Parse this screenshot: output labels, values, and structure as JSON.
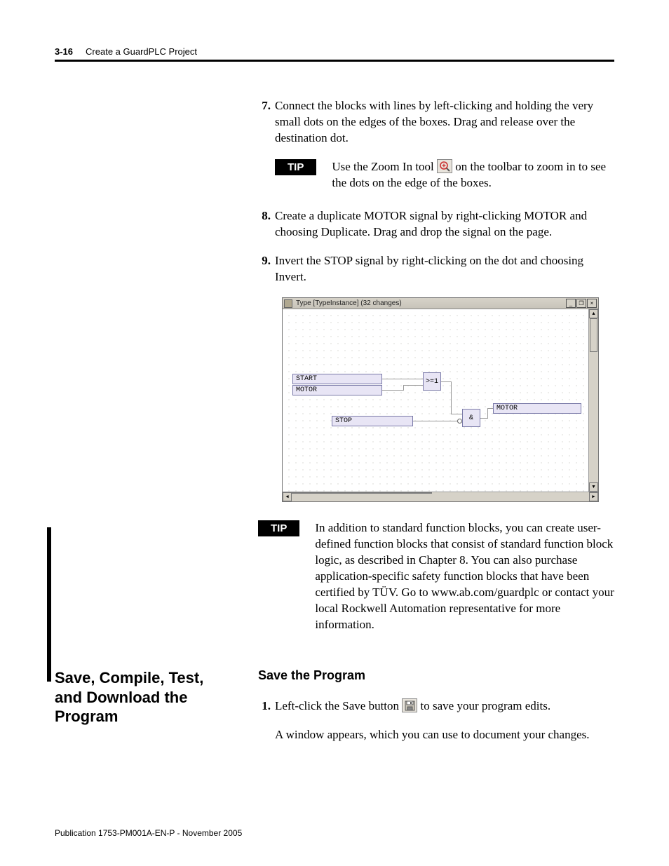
{
  "header": {
    "page_number": "3-16",
    "chapter_title": "Create a GuardPLC Project"
  },
  "steps": {
    "s7": {
      "num": "7.",
      "text": "Connect the blocks with lines by left-clicking and holding the very small dots on the edges of the boxes. Drag and release over the destination dot."
    },
    "s8": {
      "num": "8.",
      "text": "Create a duplicate MOTOR signal by right-clicking MOTOR and choosing Duplicate. Drag and drop the signal on the page."
    },
    "s9": {
      "num": "9.",
      "text": "Invert the STOP signal by right-clicking on the dot and choosing Invert."
    }
  },
  "tip1": {
    "label": "TIP",
    "before": "Use the Zoom In tool ",
    "after": " on the toolbar to zoom in to see the dots on the edge of the boxes."
  },
  "screenshot": {
    "title": "Type [TypeInstance] (32 changes)",
    "signals": {
      "start": "START",
      "motor_in": "MOTOR",
      "stop": "STOP",
      "motor_out": "MOTOR"
    },
    "gates": {
      "or": ">=1",
      "and": "&"
    }
  },
  "tip2": {
    "label": "TIP",
    "text": "In addition to standard function blocks, you can create user-defined function blocks that consist of standard function block logic, as described in Chapter 8. You can also purchase application-specific safety function blocks that have been certified by TÜV. Go to www.ab.com/guardplc or contact your local Rockwell Automation representative for more information."
  },
  "section": {
    "left_heading": "Save, Compile, Test, and Download the Program",
    "subheading": "Save the Program",
    "step1": {
      "num": "1.",
      "before": "Left-click the Save button ",
      "after": " to save your program edits."
    },
    "follow": "A window appears, which you can use to document your changes."
  },
  "publication": "Publication 1753-PM001A-EN-P - November 2005"
}
